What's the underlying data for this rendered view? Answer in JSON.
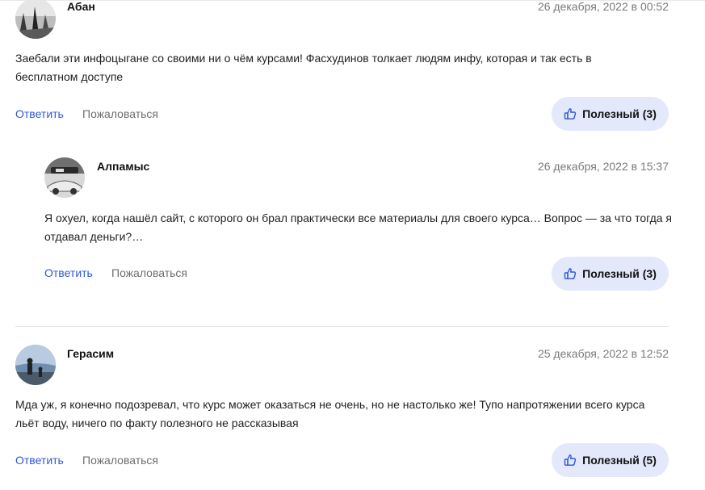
{
  "comments": [
    {
      "author": "Абан",
      "date": "26 декабря, 2022 в 00:52",
      "text": "Заебали эти инфоцыгане со своими ни о чём курсами! Фасхудинов толкает людям инфу, которая и так есть в бесплатном доступе",
      "reply_label": "Ответить",
      "report_label": "Пожаловаться",
      "useful_label": "Полезный (3)"
    },
    {
      "author": "Алпамыс",
      "date": "26 декабря, 2022 в 15:37",
      "text": "Я охуел, когда нашёл сайт, с которого он брал практически все материалы для своего курса… Вопрос — за что тогда я отдавал деньги?…",
      "reply_label": "Ответить",
      "report_label": "Пожаловаться",
      "useful_label": "Полезный (3)"
    },
    {
      "author": "Герасим",
      "date": "25 декабря, 2022 в 12:52",
      "text": "Мда уж, я конечно подозревал, что курс может оказаться не очень, но не настолько же! Тупо напротяжении всего курса льёт воду, ничего по факту полезного не рассказывая",
      "reply_label": "Ответить",
      "report_label": "Пожаловаться",
      "useful_label": "Полезный (5)"
    }
  ],
  "colors": {
    "link": "#2f57d8",
    "muted": "#6e6e6e",
    "useful_bg": "#e3e8fb"
  },
  "icons": {
    "useful": "thumbs-up-icon"
  }
}
